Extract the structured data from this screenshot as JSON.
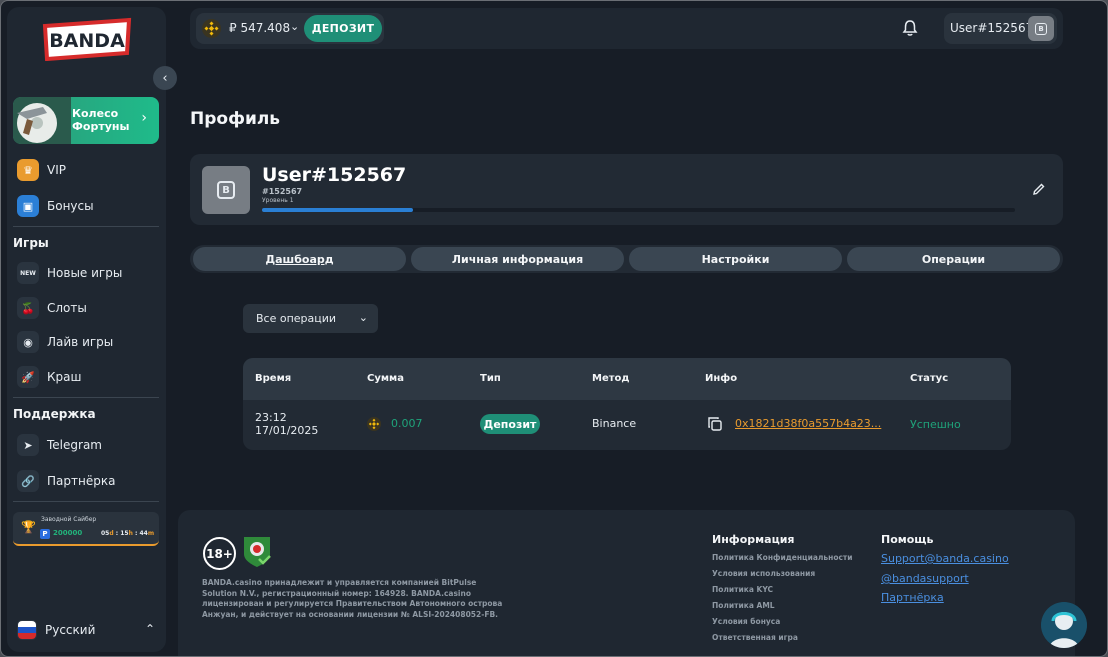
{
  "brand": {
    "logo_text": "BANDA"
  },
  "topbar": {
    "balance_value": "₽ 547.408",
    "deposit_label": "Депозит",
    "user_name": "User#152567"
  },
  "sidebar": {
    "wheel_label_1": "Колесо",
    "wheel_label_2": "Фортуны",
    "top_items": [
      {
        "label": "VIP"
      },
      {
        "label": "Бонусы"
      }
    ],
    "games_title": "Игры",
    "games": [
      {
        "label": "Новые игры",
        "icon": "NEW"
      },
      {
        "label": "Слоты"
      },
      {
        "label": "Лайв игры"
      },
      {
        "label": "Краш"
      }
    ],
    "support_title": "Поддержка",
    "support": [
      {
        "label": "Telegram"
      },
      {
        "label": "Партнёрка"
      }
    ],
    "promo": {
      "title": "Заводной Сайбер",
      "points": "200000",
      "days": "05",
      "hours": "15",
      "minutes": "44",
      "d_unit": "d",
      "h_unit": "h",
      "m_unit": "m"
    },
    "language": "Русский"
  },
  "main": {
    "page_title": "Профиль",
    "profile": {
      "name": "User#152567",
      "id": "#152567",
      "level": "Уровень 1",
      "progress": 0.2
    },
    "tabs": [
      {
        "label": "Дашбоард",
        "active": true
      },
      {
        "label": "Личная информация"
      },
      {
        "label": "Настройки"
      },
      {
        "label": "Операции"
      }
    ],
    "filter_value": "Все операции",
    "table": {
      "headers": [
        "Время",
        "Сумма",
        "Тип",
        "Метод",
        "Инфо",
        "Статус"
      ],
      "rows": [
        {
          "time": "23:12",
          "date": "17/01/2025",
          "amount": "0.007",
          "type": "Депозит",
          "method": "Binance",
          "info": "0x1821d38f0a557b4a23...",
          "status": "Успешно"
        }
      ]
    }
  },
  "footer": {
    "age_label": "18+",
    "legal_text": "BANDA.casino принадлежит и управляется компанией BitPulse Solution N.V., регистрационный номер: 164928. BANDA.casino лицензирован и регулируется Правительством Автономного острова Анжуан, и действует на основании лицензии № ALSI-202408052-FB.",
    "info_title": "Информация",
    "info_links": [
      "Политика Конфиденциальности",
      "Условия использования",
      "Политика KYC",
      "Политика AML",
      "Условия бонуса",
      "Ответственная игра"
    ],
    "help_title": "Помощь",
    "help_links": [
      "Support@banda.casino",
      "@bandasupport",
      "Партнёрка"
    ]
  },
  "colors": {
    "accent": "#1f8f77",
    "success": "#1fa37a",
    "warning": "#e99b2e",
    "bg": "#171d26",
    "panel": "#1f2731"
  }
}
